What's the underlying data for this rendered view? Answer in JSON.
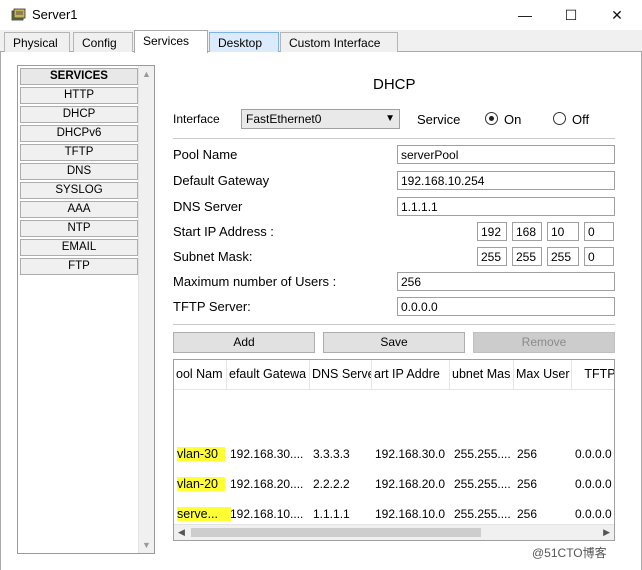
{
  "window": {
    "title": "Server1",
    "minimize_glyph": "—",
    "maximize_glyph": "☐",
    "close_glyph": "✕"
  },
  "tabs": [
    {
      "label": "Physical"
    },
    {
      "label": "Config"
    },
    {
      "label": "Services",
      "active": true
    },
    {
      "label": "Desktop"
    },
    {
      "label": "Custom Interface"
    }
  ],
  "services": {
    "header": "SERVICES",
    "items": [
      "HTTP",
      "DHCP",
      "DHCPv6",
      "TFTP",
      "DNS",
      "SYSLOG",
      "AAA",
      "NTP",
      "EMAIL",
      "FTP"
    ]
  },
  "dhcp": {
    "title": "DHCP",
    "interface_label": "Interface",
    "interface_value": "FastEthernet0",
    "service_label": "Service",
    "on_label": "On",
    "off_label": "Off",
    "service_state": "On",
    "pool_name_label": "Pool Name",
    "pool_name_value": "serverPool",
    "gateway_label": "Default Gateway",
    "gateway_value": "192.168.10.254",
    "dns_label": "DNS Server",
    "dns_value": "1.1.1.1",
    "start_ip_label": "Start IP Address :",
    "start_ip": [
      "192",
      "168",
      "10",
      "0"
    ],
    "subnet_label": "Subnet Mask:",
    "subnet": [
      "255",
      "255",
      "255",
      "0"
    ],
    "max_users_label": "Maximum number of Users :",
    "max_users_value": "256",
    "tftp_label": "TFTP Server:",
    "tftp_value": "0.0.0.0",
    "add_label": "Add",
    "save_label": "Save",
    "remove_label": "Remove"
  },
  "table": {
    "columns": [
      "ool Nam",
      "efault Gatewa",
      "DNS Serve",
      "art IP Addre",
      "ubnet Mas",
      "Max User",
      "TFTP"
    ],
    "rows": [
      [
        "vlan-30",
        "192.168.30....",
        "3.3.3.3",
        "192.168.30.0",
        "255.255....",
        "256",
        "0.0.0.0"
      ],
      [
        "vlan-20",
        "192.168.20....",
        "2.2.2.2",
        "192.168.20.0",
        "255.255....",
        "256",
        "0.0.0.0"
      ],
      [
        "serve...",
        "192.168.10....",
        "1.1.1.1",
        "192.168.10.0",
        "255.255....",
        "256",
        "0.0.0.0"
      ]
    ],
    "highlight_color": "#ffff33"
  },
  "watermark": "@51CTO博客"
}
